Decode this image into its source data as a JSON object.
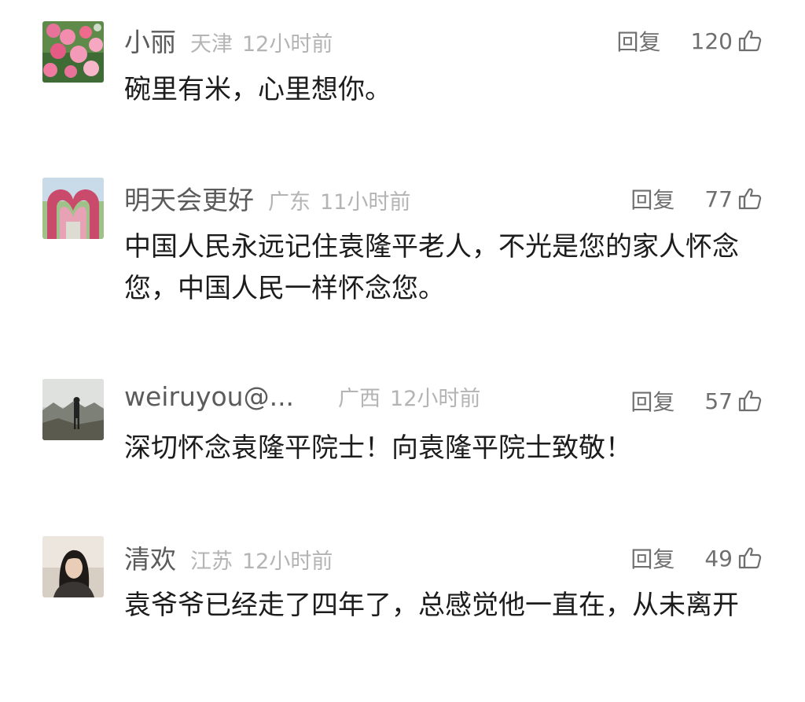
{
  "comments": [
    {
      "username": "小丽",
      "location": "天津",
      "time": "12小时前",
      "reply_label": "回复",
      "likes": "120",
      "text": "碗里有米，心里想你。",
      "avatar": "flower-wall-photo"
    },
    {
      "username": "明天会更好",
      "location": "广东",
      "time": "11小时前",
      "reply_label": "回复",
      "likes": "77",
      "text": "中国人民永远记住袁隆平老人，不光是您的家人怀念您，中国人民一样怀念您。",
      "avatar": "flower-arch-photo"
    },
    {
      "username": "weiruyou@...",
      "location": "广西",
      "time": "12小时前",
      "reply_label": "回复",
      "likes": "57",
      "text": "深切怀念袁隆平院士！向袁隆平院士致敬！",
      "avatar": "person-on-mountain-photo"
    },
    {
      "username": "清欢",
      "location": "江苏",
      "time": "12小时前",
      "reply_label": "回复",
      "likes": "49",
      "text": "袁爷爷已经走了四年了，总感觉他一直在，从未离开",
      "avatar": "woman-portrait-photo"
    }
  ],
  "colors": {
    "username": "#5b5b5b",
    "meta": "#b4b4b4",
    "text": "#1c1c1c",
    "action": "#6f6f6f"
  },
  "icons": {
    "like": "thumbs-up-icon"
  }
}
